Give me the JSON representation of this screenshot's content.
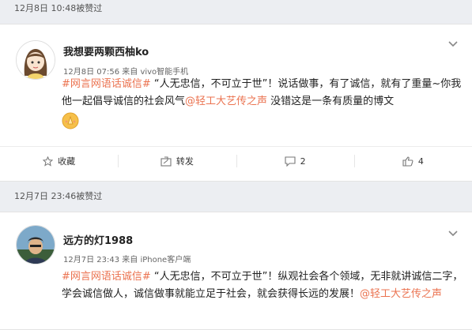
{
  "posts": [
    {
      "header": "12月8日 10:48被赞过",
      "username": "我想要两颗西柚ko",
      "meta": "12月8日 07:56 来自 vivo智能手机",
      "text": {
        "hashtag": "#网言网语话诚信#",
        "part1": " “人无忠信，不可立于世”！说话做事，有了诚信，就有了重量~你我他一起倡导诚信的社会风气",
        "mention": "@轻工大艺传之声",
        "part2": " 没错这是一条有质量的博文"
      },
      "actions": {
        "favorite_label": "收藏",
        "repost_label": "转发",
        "comment_count": "2",
        "like_count": "4"
      }
    },
    {
      "header": "12月7日 23:46被赞过",
      "username": "远方的灯1988",
      "meta": "12月7日 23:43 来自 iPhone客户端",
      "text": {
        "hashtag": "#网言网语话诚信#",
        "part1": " “人无忠信，不可立于世”！纵观社会各个领域，无非就讲诚信二字，学会诚信做人，诚信做事就能立足于社会，就会获得长远的发展！",
        "mention": "@轻工大艺传之声",
        "part2": ""
      }
    }
  ],
  "colors": {
    "accent": "#eb7350",
    "background": "#eceef2"
  },
  "icons": [
    "chevron-down-icon",
    "star-icon",
    "repost-icon",
    "comment-icon",
    "like-icon",
    "pray-emoji-icon"
  ]
}
